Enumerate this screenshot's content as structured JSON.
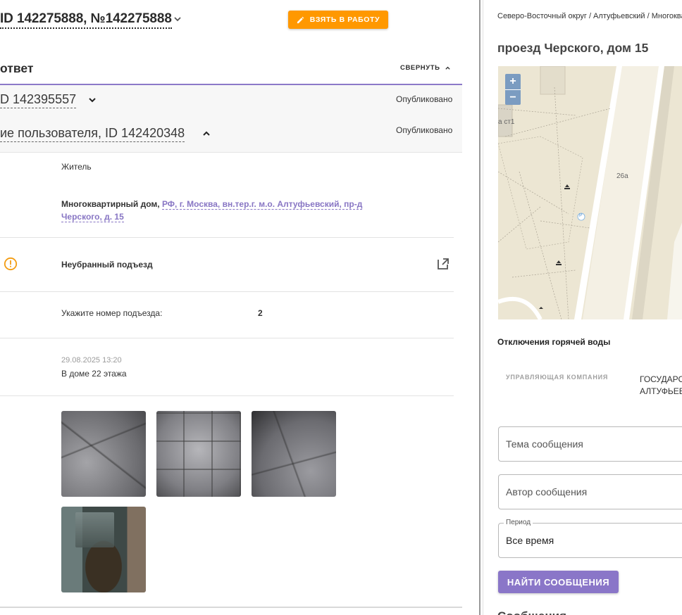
{
  "ticket": {
    "title": "ID 142275888, №142275888",
    "take_button": "ВЗЯТЬ В РАБОТУ"
  },
  "answer": {
    "title": "ответ",
    "collapse": "СВЕРНУТЬ"
  },
  "rows": {
    "id_title": "D 142395557",
    "id_status": "Опубликовано",
    "user_title": "ие пользователя, ID 142420348",
    "user_status": "Опубликовано"
  },
  "details": {
    "role": "Житель",
    "addr_prefix": "Многоквартирный дом, ",
    "addr_link": "РФ, г. Москва, вн.тер.г. м.о. Алтуфьевский, пр-д Черского, д. 15",
    "issue": "Неубранный подъезд",
    "entrance_label": "Укажите номер подъезда:",
    "entrance_value": "2",
    "date": "29.08.2025 13:20",
    "comment": "В доме 22 этажа"
  },
  "photos": [
    "floor-photo-1",
    "floor-photo-2",
    "floor-photo-3",
    "entrance-photo-4"
  ],
  "right": {
    "breadcrumbs": "Северо-Восточный округ / Алтуфьевский / Многоквартирный дом",
    "address": "проезд Черского, дом 15",
    "map": {
      "zoom_in": "+",
      "zoom_out": "−",
      "label_house": "26а",
      "label_building": "а ст1",
      "label_parking": "P"
    },
    "hot_water": "Отключения горячей воды",
    "mc_label": "УПРАВЛЯЮЩАЯ КОМПАНИЯ",
    "mc_value_1": "ГОСУДАРС",
    "mc_value_2": "АЛТУФЬЕВ",
    "subject_placeholder": "Тема сообщения",
    "author_placeholder": "Автор сообщения",
    "period_label": "Период",
    "period_value": "Все время",
    "find_button": "НАЙТИ СООБЩЕНИЯ",
    "cut_heading": "Сообщения"
  },
  "colors": {
    "accent_orange": "#ff9800",
    "accent_purple": "#8a76c8",
    "link_purple": "#8876c4",
    "warning": "#f39c12"
  }
}
